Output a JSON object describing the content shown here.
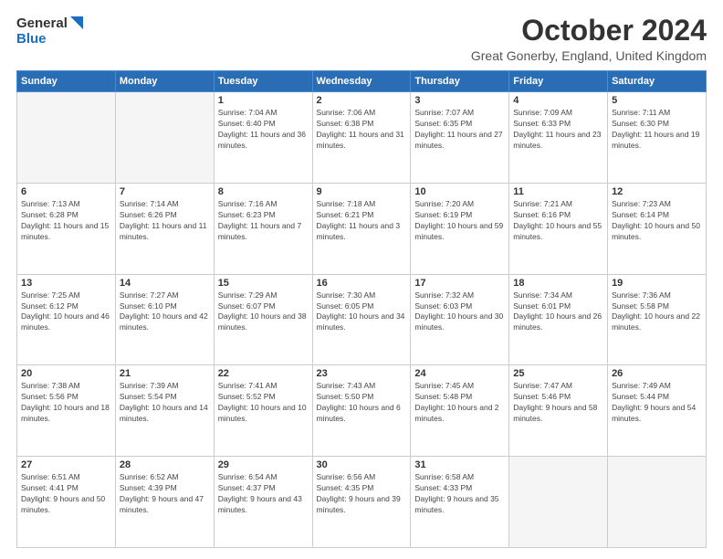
{
  "header": {
    "logo_general": "General",
    "logo_blue": "Blue",
    "title": "October 2024",
    "subtitle": "Great Gonerby, England, United Kingdom"
  },
  "calendar": {
    "days_of_week": [
      "Sunday",
      "Monday",
      "Tuesday",
      "Wednesday",
      "Thursday",
      "Friday",
      "Saturday"
    ],
    "weeks": [
      [
        {
          "day": "",
          "content": ""
        },
        {
          "day": "",
          "content": ""
        },
        {
          "day": "1",
          "content": "Sunrise: 7:04 AM\nSunset: 6:40 PM\nDaylight: 11 hours and 36 minutes."
        },
        {
          "day": "2",
          "content": "Sunrise: 7:06 AM\nSunset: 6:38 PM\nDaylight: 11 hours and 31 minutes."
        },
        {
          "day": "3",
          "content": "Sunrise: 7:07 AM\nSunset: 6:35 PM\nDaylight: 11 hours and 27 minutes."
        },
        {
          "day": "4",
          "content": "Sunrise: 7:09 AM\nSunset: 6:33 PM\nDaylight: 11 hours and 23 minutes."
        },
        {
          "day": "5",
          "content": "Sunrise: 7:11 AM\nSunset: 6:30 PM\nDaylight: 11 hours and 19 minutes."
        }
      ],
      [
        {
          "day": "6",
          "content": "Sunrise: 7:13 AM\nSunset: 6:28 PM\nDaylight: 11 hours and 15 minutes."
        },
        {
          "day": "7",
          "content": "Sunrise: 7:14 AM\nSunset: 6:26 PM\nDaylight: 11 hours and 11 minutes."
        },
        {
          "day": "8",
          "content": "Sunrise: 7:16 AM\nSunset: 6:23 PM\nDaylight: 11 hours and 7 minutes."
        },
        {
          "day": "9",
          "content": "Sunrise: 7:18 AM\nSunset: 6:21 PM\nDaylight: 11 hours and 3 minutes."
        },
        {
          "day": "10",
          "content": "Sunrise: 7:20 AM\nSunset: 6:19 PM\nDaylight: 10 hours and 59 minutes."
        },
        {
          "day": "11",
          "content": "Sunrise: 7:21 AM\nSunset: 6:16 PM\nDaylight: 10 hours and 55 minutes."
        },
        {
          "day": "12",
          "content": "Sunrise: 7:23 AM\nSunset: 6:14 PM\nDaylight: 10 hours and 50 minutes."
        }
      ],
      [
        {
          "day": "13",
          "content": "Sunrise: 7:25 AM\nSunset: 6:12 PM\nDaylight: 10 hours and 46 minutes."
        },
        {
          "day": "14",
          "content": "Sunrise: 7:27 AM\nSunset: 6:10 PM\nDaylight: 10 hours and 42 minutes."
        },
        {
          "day": "15",
          "content": "Sunrise: 7:29 AM\nSunset: 6:07 PM\nDaylight: 10 hours and 38 minutes."
        },
        {
          "day": "16",
          "content": "Sunrise: 7:30 AM\nSunset: 6:05 PM\nDaylight: 10 hours and 34 minutes."
        },
        {
          "day": "17",
          "content": "Sunrise: 7:32 AM\nSunset: 6:03 PM\nDaylight: 10 hours and 30 minutes."
        },
        {
          "day": "18",
          "content": "Sunrise: 7:34 AM\nSunset: 6:01 PM\nDaylight: 10 hours and 26 minutes."
        },
        {
          "day": "19",
          "content": "Sunrise: 7:36 AM\nSunset: 5:58 PM\nDaylight: 10 hours and 22 minutes."
        }
      ],
      [
        {
          "day": "20",
          "content": "Sunrise: 7:38 AM\nSunset: 5:56 PM\nDaylight: 10 hours and 18 minutes."
        },
        {
          "day": "21",
          "content": "Sunrise: 7:39 AM\nSunset: 5:54 PM\nDaylight: 10 hours and 14 minutes."
        },
        {
          "day": "22",
          "content": "Sunrise: 7:41 AM\nSunset: 5:52 PM\nDaylight: 10 hours and 10 minutes."
        },
        {
          "day": "23",
          "content": "Sunrise: 7:43 AM\nSunset: 5:50 PM\nDaylight: 10 hours and 6 minutes."
        },
        {
          "day": "24",
          "content": "Sunrise: 7:45 AM\nSunset: 5:48 PM\nDaylight: 10 hours and 2 minutes."
        },
        {
          "day": "25",
          "content": "Sunrise: 7:47 AM\nSunset: 5:46 PM\nDaylight: 9 hours and 58 minutes."
        },
        {
          "day": "26",
          "content": "Sunrise: 7:49 AM\nSunset: 5:44 PM\nDaylight: 9 hours and 54 minutes."
        }
      ],
      [
        {
          "day": "27",
          "content": "Sunrise: 6:51 AM\nSunset: 4:41 PM\nDaylight: 9 hours and 50 minutes."
        },
        {
          "day": "28",
          "content": "Sunrise: 6:52 AM\nSunset: 4:39 PM\nDaylight: 9 hours and 47 minutes."
        },
        {
          "day": "29",
          "content": "Sunrise: 6:54 AM\nSunset: 4:37 PM\nDaylight: 9 hours and 43 minutes."
        },
        {
          "day": "30",
          "content": "Sunrise: 6:56 AM\nSunset: 4:35 PM\nDaylight: 9 hours and 39 minutes."
        },
        {
          "day": "31",
          "content": "Sunrise: 6:58 AM\nSunset: 4:33 PM\nDaylight: 9 hours and 35 minutes."
        },
        {
          "day": "",
          "content": ""
        },
        {
          "day": "",
          "content": ""
        }
      ]
    ]
  }
}
